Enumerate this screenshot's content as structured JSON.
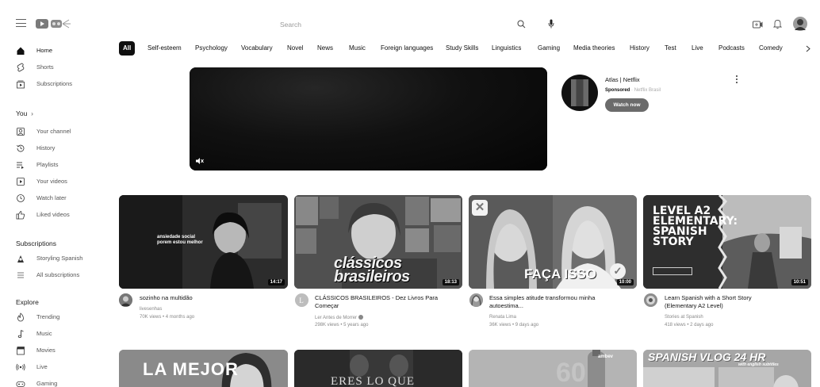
{
  "header": {
    "search_placeholder": "Search"
  },
  "chips": [
    {
      "label": "All",
      "active": true
    },
    {
      "label": "Self-esteem"
    },
    {
      "label": "Psychology"
    },
    {
      "label": "Vocabulary"
    },
    {
      "label": "Novel"
    },
    {
      "label": "News"
    },
    {
      "label": "Music"
    },
    {
      "label": "Foreign languages"
    },
    {
      "label": "Study Skills"
    },
    {
      "label": "Linguistics"
    },
    {
      "label": "Gaming"
    },
    {
      "label": "Media theories"
    },
    {
      "label": "History"
    },
    {
      "label": "Test"
    },
    {
      "label": "Live"
    },
    {
      "label": "Podcasts"
    },
    {
      "label": "Comedy"
    }
  ],
  "sidebar": {
    "home": "Home",
    "shorts": "Shorts",
    "subscriptions": "Subscriptions",
    "you_heading": "You",
    "you_items": [
      "Your channel",
      "History",
      "Playlists",
      "Your videos",
      "Watch later",
      "Liked videos"
    ],
    "subs_heading": "Subscriptions",
    "subs_items": [
      "Storyling Spanish",
      "All subscriptions"
    ],
    "explore_heading": "Explore",
    "explore_items": [
      "Trending",
      "Music",
      "Movies",
      "Live",
      "Gaming"
    ]
  },
  "ad": {
    "title": "Atlas | Netflix",
    "sponsored": "Sponsored",
    "advertiser": "Netflix Brasil",
    "button": "Watch now"
  },
  "videos": [
    {
      "title_line1": "sozinho na multidão",
      "title_line2": "",
      "channel": "livesenhas",
      "meta": "70K views • 4 months ago",
      "duration": "14:17",
      "thumb_text": "ansiedade social\nporem estou melhor"
    },
    {
      "title_line1": "CLÁSSICOS BRASILEIROS - Dez Livros Para",
      "title_line2": "Começar",
      "channel": "Ler Antes de Morrer",
      "meta": "298K views • 5 years ago",
      "duration": "18:13",
      "thumb_text": "clássicos brasileiros"
    },
    {
      "title_line1": "Essa simples atitude transformou minha",
      "title_line2": "autoestima...",
      "channel": "Renata Lima",
      "meta": "36K views • 9 days ago",
      "duration": "10:00",
      "thumb_text": "FAÇA ISSO"
    },
    {
      "title_line1": "Learn Spanish with a Short Story",
      "title_line2": "(Elementary A2 Level)",
      "channel": "Stories at Spanish",
      "meta": "418 views • 2 days ago",
      "duration": "10:51",
      "thumb_text": "LEVEL A2 ELEMENTARY: SPANISH STORY"
    }
  ],
  "row2": [
    {
      "thumb_text": "LA MEJOR"
    },
    {
      "thumb_text": "ERES LO QUE"
    },
    {
      "thumb_text": "ambev"
    },
    {
      "thumb_text": "SPANISH VLOG 24 HR",
      "sub_text": "with english subtitles"
    }
  ],
  "colors": {
    "accent": "#0f0f0f",
    "text_secondary": "#606060"
  }
}
